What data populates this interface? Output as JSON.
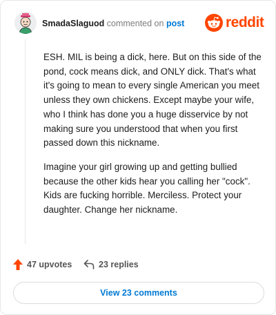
{
  "header": {
    "username": "SmadaSlaguod",
    "verb": "commented on",
    "post_link": "post",
    "brand": "reddit"
  },
  "comment": {
    "paragraphs": [
      "ESH. MIL is being a dick, here. But on this side of the pond, cock means dick, and ONLY dick. That's what it's going to mean to every single American you meet unless they own chickens. Except maybe your wife, who I think has done you a huge disservice by not making sure you understood that when you first passed down this nickname.",
      "Imagine your girl growing up and getting bullied because the other kids hear you calling her \"cock\". Kids are fucking horrible. Merciless. Protect your daughter. Change her nickname."
    ]
  },
  "actions": {
    "upvotes": "47 upvotes",
    "replies": "23 replies"
  },
  "view_button": "View 23 comments",
  "colors": {
    "brand": "#ff4500",
    "link": "#0079d3",
    "upvote": "#ff4500"
  }
}
